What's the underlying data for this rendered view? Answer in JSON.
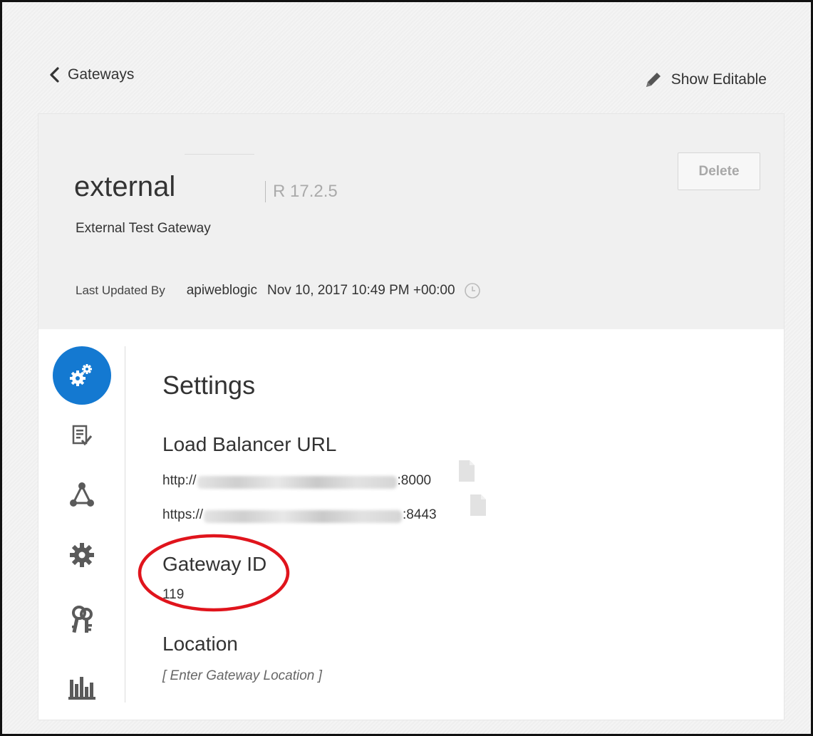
{
  "nav": {
    "back_label": "Gateways",
    "show_editable_label": "Show Editable"
  },
  "gateway": {
    "name": "external",
    "version": "R 17.2.5",
    "description": "External Test Gateway",
    "delete_label": "Delete",
    "last_updated_label": "Last Updated By",
    "last_updated_user": "apiweblogic",
    "last_updated_time": "Nov 10, 2017 10:49 PM +00:00"
  },
  "sidebar": {
    "items": [
      {
        "icon": "settings-gears-icon",
        "active": true
      },
      {
        "icon": "checklist-icon",
        "active": false
      },
      {
        "icon": "nodes-icon",
        "active": false
      },
      {
        "icon": "gear-icon",
        "active": false
      },
      {
        "icon": "keys-icon",
        "active": false
      },
      {
        "icon": "analytics-chart-icon",
        "active": false
      }
    ]
  },
  "settings": {
    "title": "Settings",
    "load_balancer_label": "Load Balancer URL",
    "http_prefix": "http://",
    "http_suffix": ":8000",
    "https_prefix": "https://",
    "https_suffix": ":8443",
    "gateway_id_label": "Gateway ID",
    "gateway_id_value": "119",
    "location_label": "Location",
    "location_placeholder": "[ Enter Gateway Location ]"
  },
  "colors": {
    "accent": "#1479d1",
    "highlight": "#e0141c",
    "header_bg": "#f0f0f0",
    "icon_gray": "#5a5a5a"
  }
}
